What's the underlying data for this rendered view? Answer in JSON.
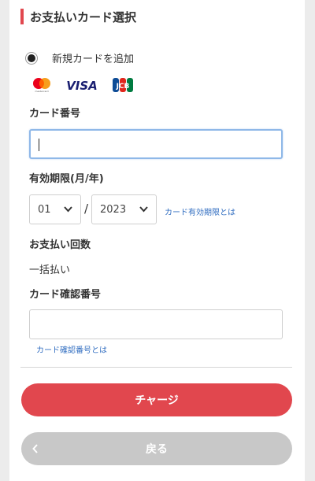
{
  "section": {
    "title": "お支払いカード選択"
  },
  "new_card": {
    "label": "新規カードを追加",
    "selected": true
  },
  "brands": [
    {
      "name": "mastercard-icon",
      "caption": "mastercard"
    },
    {
      "name": "visa-icon",
      "text": "VISA"
    },
    {
      "name": "jcb-icon",
      "text": "JCB"
    }
  ],
  "card_number": {
    "label": "カード番号",
    "value": ""
  },
  "expiry": {
    "label": "有効期限(月/年)",
    "month": "01",
    "separator": "/",
    "year": "2023",
    "help_link": "カード有効期限とは"
  },
  "payment_count": {
    "label": "お支払い回数",
    "value": "一括払い"
  },
  "security_code": {
    "label": "カード確認番号",
    "value": "",
    "help_link": "カード確認番号とは"
  },
  "buttons": {
    "charge": "チャージ",
    "back": "戻る"
  },
  "colors": {
    "accent": "#e1474e",
    "link": "#2f6cc0",
    "disabled": "#c8c8c8"
  }
}
